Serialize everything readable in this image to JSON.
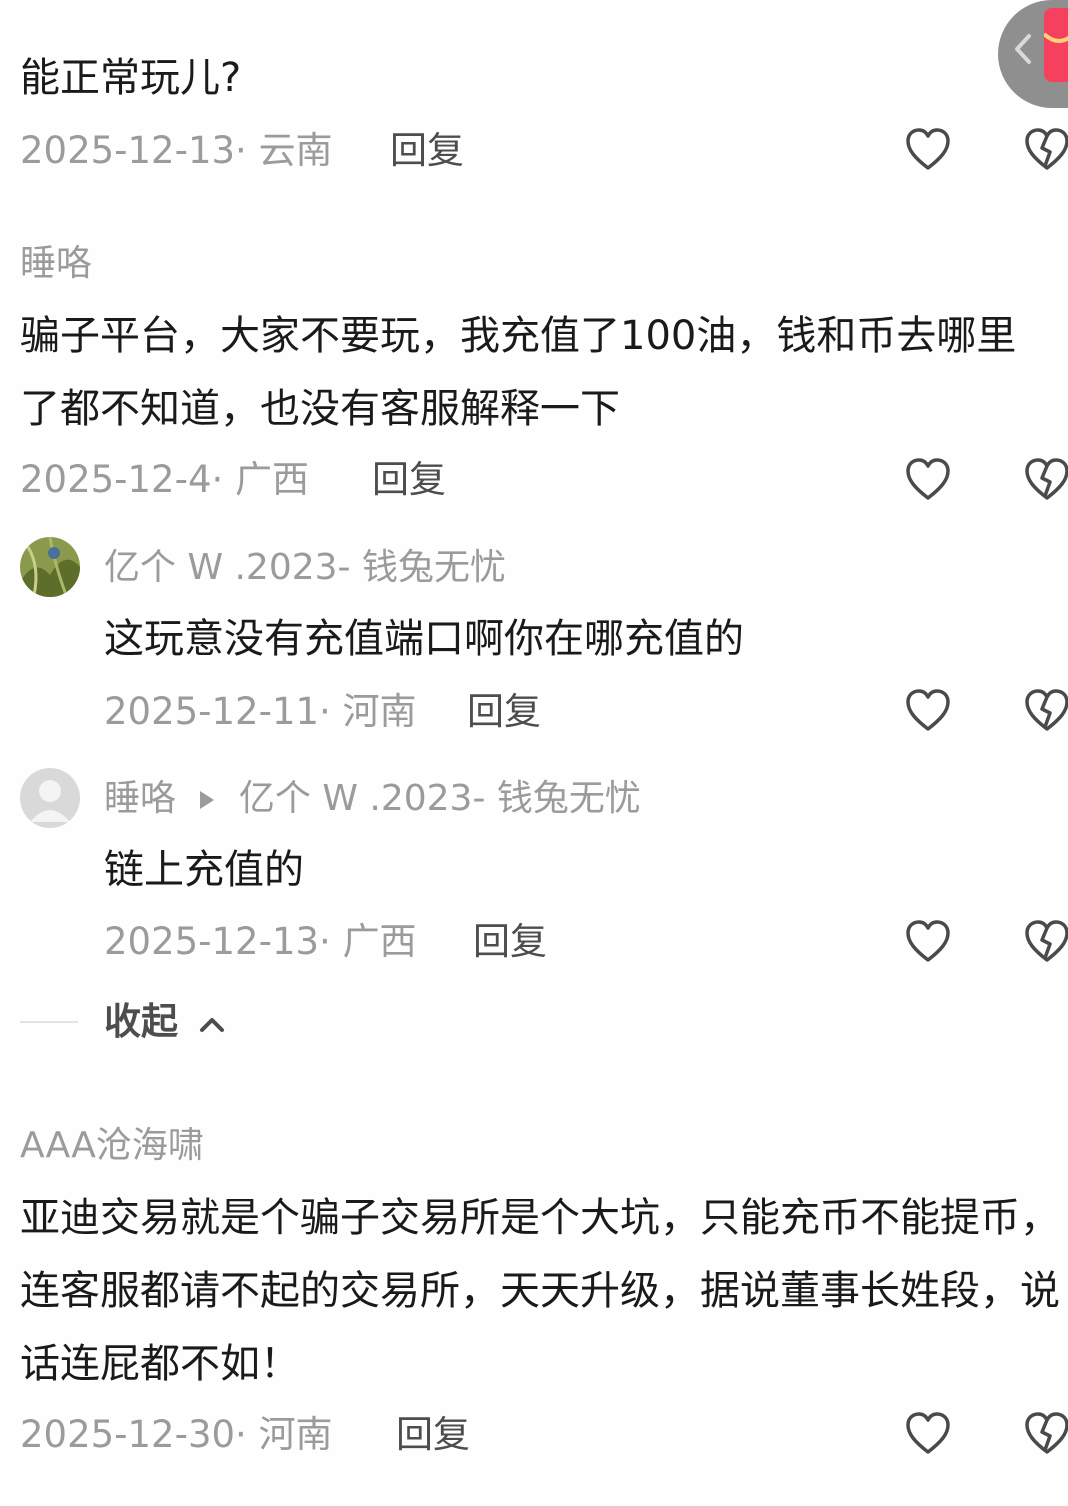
{
  "comments": [
    {
      "text": "能正常玩儿?",
      "date": "2025-12-13",
      "region": "云南",
      "reply_label": "回复"
    },
    {
      "author": "睡咯",
      "text": "骗子平台，大家不要玩，我充值了100油，钱和币去哪里了都不知道，也没有客服解释一下",
      "date": "2025-12-4",
      "region": "广西",
      "reply_label": "回复",
      "replies": [
        {
          "author": "亿个 W .2023- 钱兔无忧",
          "text": "这玩意没有充值端口啊你在哪充值的",
          "date": "2025-12-11",
          "region": "河南",
          "reply_label": "回复"
        },
        {
          "author": "睡咯",
          "reply_to": "亿个 W .2023- 钱兔无忧",
          "text": "链上充值的",
          "date": "2025-12-13",
          "region": "广西",
          "reply_label": "回复"
        }
      ],
      "collapse_label": "收起"
    },
    {
      "author": "AAA沧海啸",
      "text": "亚迪交易就是个骗子交易所是个大坑，只能充币不能提币，连客服都请不起的交易所，天天升级，据说董事长姓段，说话连屁都不如！",
      "date": "2025-12-30",
      "region": "河南",
      "reply_label": "回复"
    }
  ],
  "separator": "·",
  "icons": {
    "like": "heart-outline-icon",
    "dislike": "broken-heart-icon",
    "collapse": "chevron-up-icon",
    "reply_arrow": "triangle-right-icon",
    "float": "back-chevron-icon"
  },
  "colors": {
    "background": "#fefefe",
    "text": "#1a1a1a",
    "meta": "#9b9b9b",
    "reply": "#4d4d4d",
    "float_button": "#8f8f8f",
    "float_badge": "#f5405e"
  }
}
